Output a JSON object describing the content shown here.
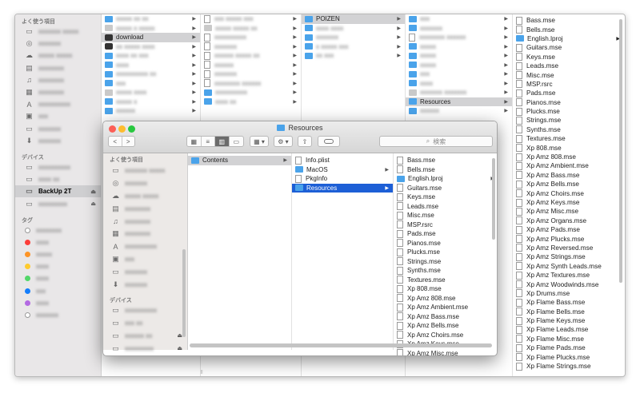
{
  "bg_window": {
    "sidebar": {
      "favorites_header": "よく使う項目",
      "devices_header": "デバイス",
      "tags_header": "タグ",
      "selected_device": "BackUp 2T",
      "eject_icon": "eject-icon"
    },
    "column_download": "download",
    "column_poizen": "POIZEN",
    "column_resources": "Resources",
    "column_last": {
      "items": [
        {
          "name": "Bass.mse",
          "kind": "doc"
        },
        {
          "name": "Bells.mse",
          "kind": "doc"
        },
        {
          "name": "English.lproj",
          "kind": "folder"
        },
        {
          "name": "Guitars.mse",
          "kind": "doc"
        },
        {
          "name": "Keys.mse",
          "kind": "doc"
        },
        {
          "name": "Leads.mse",
          "kind": "doc"
        },
        {
          "name": "Misc.mse",
          "kind": "doc"
        },
        {
          "name": "MSP.rsrc",
          "kind": "doc"
        },
        {
          "name": "Pads.mse",
          "kind": "doc"
        },
        {
          "name": "Pianos.mse",
          "kind": "doc"
        },
        {
          "name": "Plucks.mse",
          "kind": "doc"
        },
        {
          "name": "Strings.mse",
          "kind": "doc"
        },
        {
          "name": "Synths.mse",
          "kind": "doc"
        },
        {
          "name": "Textures.mse",
          "kind": "doc"
        },
        {
          "name": "Xp 808.mse",
          "kind": "doc"
        },
        {
          "name": "Xp Amz 808.mse",
          "kind": "doc"
        },
        {
          "name": "Xp Amz Ambient.mse",
          "kind": "doc"
        },
        {
          "name": "Xp Amz Bass.mse",
          "kind": "doc"
        },
        {
          "name": "Xp Amz Bells.mse",
          "kind": "doc"
        },
        {
          "name": "Xp Amz Choirs.mse",
          "kind": "doc"
        },
        {
          "name": "Xp Amz Keys.mse",
          "kind": "doc"
        },
        {
          "name": "Xp Amz Misc.mse",
          "kind": "doc"
        },
        {
          "name": "Xp Amz Organs.mse",
          "kind": "doc"
        },
        {
          "name": "Xp Amz Pads.mse",
          "kind": "doc"
        },
        {
          "name": "Xp Amz Plucks.mse",
          "kind": "doc"
        },
        {
          "name": "Xp Amz Reversed.mse",
          "kind": "doc"
        },
        {
          "name": "Xp Amz Strings.mse",
          "kind": "doc"
        },
        {
          "name": "Xp Amz Synth Leads.mse",
          "kind": "doc"
        },
        {
          "name": "Xp Amz Textures.mse",
          "kind": "doc"
        },
        {
          "name": "Xp Amz Woodwinds.mse",
          "kind": "doc"
        },
        {
          "name": "Xp Drums.mse",
          "kind": "doc"
        },
        {
          "name": "Xp Flame Bass.mse",
          "kind": "doc"
        },
        {
          "name": "Xp Flame Bells.mse",
          "kind": "doc"
        },
        {
          "name": "Xp Flame Keys.mse",
          "kind": "doc"
        },
        {
          "name": "Xp Flame Leads.mse",
          "kind": "doc"
        },
        {
          "name": "Xp Flame Misc.mse",
          "kind": "doc"
        },
        {
          "name": "Xp Flame Pads.mse",
          "kind": "doc"
        },
        {
          "name": "Xp Flame Plucks.mse",
          "kind": "doc"
        },
        {
          "name": "Xp Flame Strings.mse",
          "kind": "doc"
        }
      ]
    }
  },
  "front_window": {
    "title": "Resources",
    "search_placeholder": "検索",
    "sidebar": {
      "favorites_header": "よく使う項目",
      "devices_header": "デバイス"
    },
    "col1": [
      {
        "name": "Contents",
        "kind": "folder",
        "state": "hl"
      }
    ],
    "col2": [
      {
        "name": "Info.plist",
        "kind": "doc",
        "state": ""
      },
      {
        "name": "MacOS",
        "kind": "folder",
        "state": ""
      },
      {
        "name": "PkgInfo",
        "kind": "doc",
        "state": ""
      },
      {
        "name": "Resources",
        "kind": "folder",
        "state": "sel"
      }
    ],
    "col3": [
      {
        "name": "Bass.mse",
        "kind": "doc"
      },
      {
        "name": "Bells.mse",
        "kind": "doc"
      },
      {
        "name": "English.lproj",
        "kind": "folder"
      },
      {
        "name": "Guitars.mse",
        "kind": "doc"
      },
      {
        "name": "Keys.mse",
        "kind": "doc"
      },
      {
        "name": "Leads.mse",
        "kind": "doc"
      },
      {
        "name": "Misc.mse",
        "kind": "doc"
      },
      {
        "name": "MSP.rsrc",
        "kind": "doc"
      },
      {
        "name": "Pads.mse",
        "kind": "doc"
      },
      {
        "name": "Pianos.mse",
        "kind": "doc"
      },
      {
        "name": "Plucks.mse",
        "kind": "doc"
      },
      {
        "name": "Strings.mse",
        "kind": "doc"
      },
      {
        "name": "Synths.mse",
        "kind": "doc"
      },
      {
        "name": "Textures.mse",
        "kind": "doc"
      },
      {
        "name": "Xp 808.mse",
        "kind": "doc"
      },
      {
        "name": "Xp Amz 808.mse",
        "kind": "doc"
      },
      {
        "name": "Xp Amz Ambient.mse",
        "kind": "doc"
      },
      {
        "name": "Xp Amz Bass.mse",
        "kind": "doc"
      },
      {
        "name": "Xp Amz Bells.mse",
        "kind": "doc"
      },
      {
        "name": "Xp Amz Choirs.mse",
        "kind": "doc"
      },
      {
        "name": "Xp Amz Keys.mse",
        "kind": "doc"
      },
      {
        "name": "Xp Amz Misc.mse",
        "kind": "doc"
      }
    ]
  },
  "colors": {
    "selection_blue": "#1d5fd6",
    "folder_blue": "#4aa3ea",
    "traffic_red": "#fc5f57",
    "traffic_yellow": "#fdbc2e",
    "traffic_green": "#28c83f"
  }
}
